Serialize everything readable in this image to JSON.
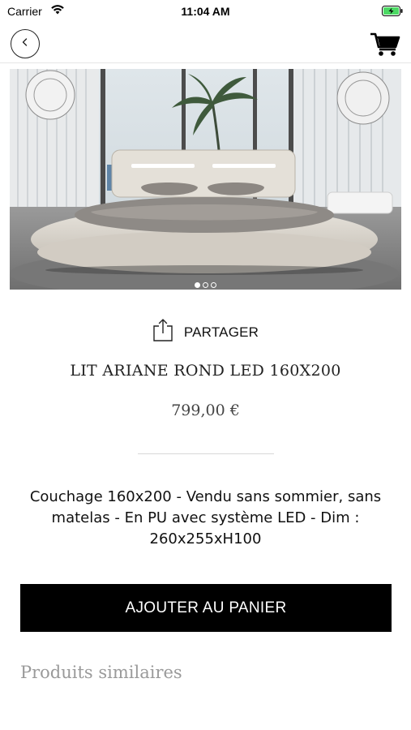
{
  "status_bar": {
    "carrier": "Carrier",
    "time": "11:04 AM",
    "wifi_icon": "wifi-icon",
    "battery_icon": "battery-charging-icon",
    "battery_color": "#4cd964"
  },
  "nav": {
    "back_icon": "chevron-left-icon",
    "cart_icon": "shopping-cart-icon"
  },
  "carousel": {
    "image": "bed-photo",
    "pages": 3,
    "active_page": 1
  },
  "share": {
    "label": "PARTAGER",
    "icon": "share-icon"
  },
  "product": {
    "title": "LIT ARIANE ROND LED 160X200",
    "price": "799,00 €",
    "description": "Couchage 160x200 - Vendu sans sommier, sans matelas - En PU avec système LED - Dim : 260x255xH100"
  },
  "actions": {
    "add_to_cart": "AJOUTER AU PANIER"
  },
  "similar": {
    "heading": "Produits similaires"
  },
  "colors": {
    "primary_button": "#000000",
    "heading_muted": "#9a9a9a"
  }
}
